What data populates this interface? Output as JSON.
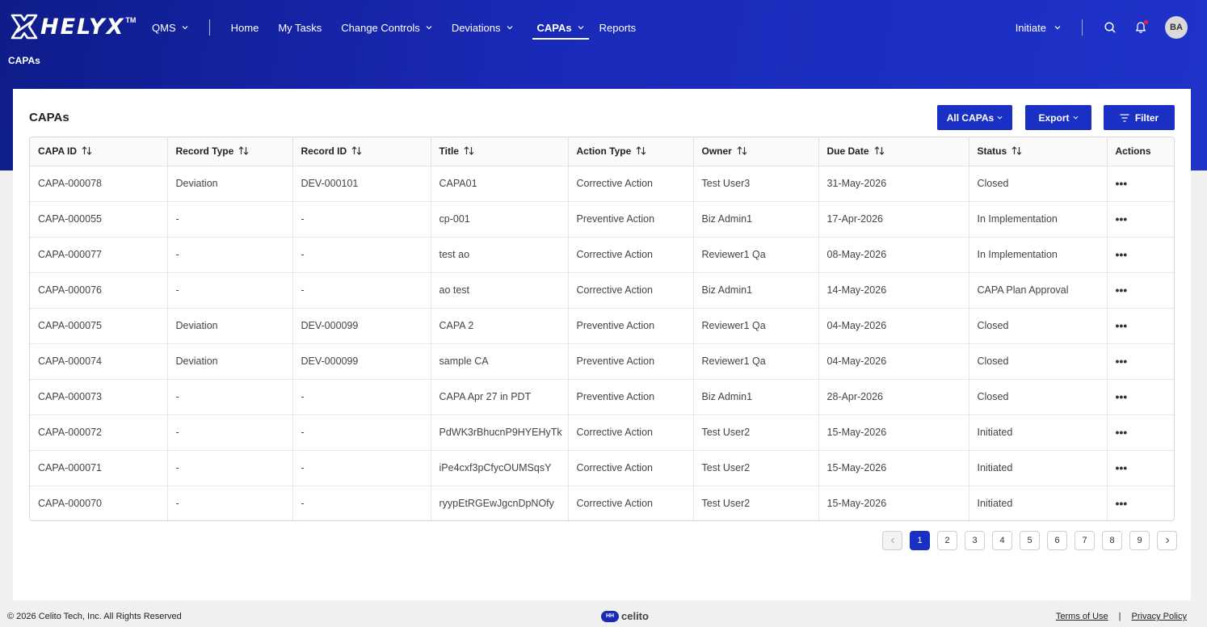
{
  "brand": {
    "name": "HELYX",
    "tm": "TM"
  },
  "nav": {
    "items": [
      {
        "label": "QMS",
        "dropdown": true,
        "active": false
      },
      {
        "label": "Home",
        "dropdown": false,
        "active": false
      },
      {
        "label": "My Tasks",
        "dropdown": false,
        "active": false
      },
      {
        "label": "Change Controls",
        "dropdown": true,
        "active": false
      },
      {
        "label": "Deviations",
        "dropdown": true,
        "active": false
      },
      {
        "label": "CAPAs",
        "dropdown": true,
        "active": true
      },
      {
        "label": "Reports",
        "dropdown": false,
        "active": false
      }
    ],
    "initiate_label": "Initiate",
    "avatar_initials": "BA"
  },
  "breadcrumb": "CAPAs",
  "card": {
    "title": "CAPAs",
    "all_capas_label": "All CAPAs",
    "export_label": "Export",
    "filter_label": "Filter"
  },
  "table": {
    "columns": [
      "CAPA ID",
      "Record Type",
      "Record ID",
      "Title",
      "Action Type",
      "Owner",
      "Due Date",
      "Status",
      "Actions"
    ],
    "rows": [
      [
        "CAPA-000078",
        "Deviation",
        "DEV-000101",
        "CAPA01",
        "Corrective Action",
        "Test User3",
        "31-May-2026",
        "Closed"
      ],
      [
        "CAPA-000055",
        "-",
        "-",
        "cp-001",
        "Preventive Action",
        "Biz Admin1",
        "17-Apr-2026",
        "In Implementation"
      ],
      [
        "CAPA-000077",
        "-",
        "-",
        "test ao",
        "Corrective Action",
        "Reviewer1 Qa",
        "08-May-2026",
        "In Implementation"
      ],
      [
        "CAPA-000076",
        "-",
        "-",
        "ao test",
        "Corrective Action",
        "Biz Admin1",
        "14-May-2026",
        "CAPA Plan Approval"
      ],
      [
        "CAPA-000075",
        "Deviation",
        "DEV-000099",
        "CAPA 2",
        "Preventive Action",
        "Reviewer1 Qa",
        "04-May-2026",
        "Closed"
      ],
      [
        "CAPA-000074",
        "Deviation",
        "DEV-000099",
        "sample CA",
        "Preventive Action",
        "Reviewer1 Qa",
        "04-May-2026",
        "Closed"
      ],
      [
        "CAPA-000073",
        "-",
        "-",
        "CAPA Apr 27 in PDT",
        "Preventive Action",
        "Biz Admin1",
        "28-Apr-2026",
        "Closed"
      ],
      [
        "CAPA-000072",
        "-",
        "-",
        "PdWK3rBhucnP9HYEHyTk",
        "Corrective Action",
        "Test User2",
        "15-May-2026",
        "Initiated"
      ],
      [
        "CAPA-000071",
        "-",
        "-",
        "iPe4cxf3pCfycOUMSqsY",
        "Corrective Action",
        "Test User2",
        "15-May-2026",
        "Initiated"
      ],
      [
        "CAPA-000070",
        "-",
        "-",
        "ryypEtRGEwJgcnDpNOfy",
        "Corrective Action",
        "Test User2",
        "15-May-2026",
        "Initiated"
      ]
    ],
    "actions_glyph": "•••"
  },
  "pagination": {
    "pages": [
      "1",
      "2",
      "3",
      "4",
      "5",
      "6",
      "7",
      "8",
      "9"
    ],
    "current": "1"
  },
  "footer": {
    "copyright": "© 2026 Celito Tech, Inc. All Rights Reserved",
    "logo_badge": "HH",
    "logo_text": "celito",
    "terms": "Terms of Use",
    "separator": "|",
    "privacy": "Privacy Policy"
  },
  "colors": {
    "primary": "#1a30c4",
    "header_gradient_start": "#0f1c8a",
    "header_gradient_end": "#1e33c9"
  }
}
